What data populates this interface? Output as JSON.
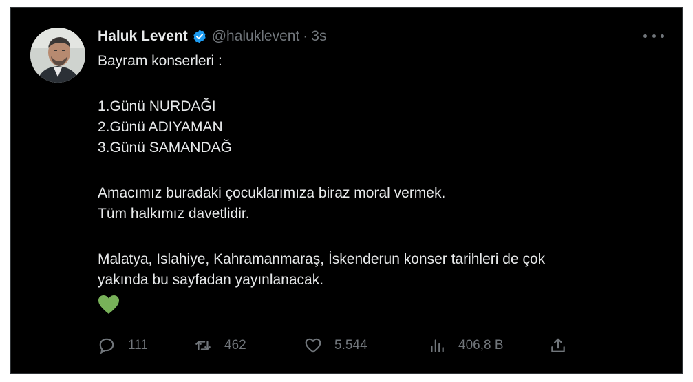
{
  "tweet": {
    "author_name": "Haluk Levent",
    "handle": "@haluklevent",
    "separator": "·",
    "time": "3s",
    "lines": [
      "Bayram konserleri :",
      "1.Günü NURDAĞI",
      "2.Günü ADIYAMAN",
      "3.Günü SAMANDAĞ",
      "Amacımız buradaki çocuklarımıza biraz moral vermek.",
      "Tüm halkımız davetlidir.",
      "Malatya, Islahiye, Kahramanmaraş, İskenderun konser tarihleri de çok",
      "yakında bu sayfadan yayınlanacak."
    ],
    "emoji": "green-heart"
  },
  "actions": {
    "replies": "111",
    "retweets": "462",
    "likes": "5.544",
    "views": "406,8 B"
  },
  "icons": {
    "verified": "verified-badge-icon",
    "more": "more-options-icon",
    "reply": "reply-icon",
    "retweet": "retweet-icon",
    "like": "heart-icon",
    "views": "views-icon",
    "share": "share-icon"
  },
  "colors": {
    "background": "#000000",
    "text": "#e7e9ea",
    "muted": "#71767b",
    "verified": "#1d9bf0",
    "emoji": "#78b159"
  }
}
